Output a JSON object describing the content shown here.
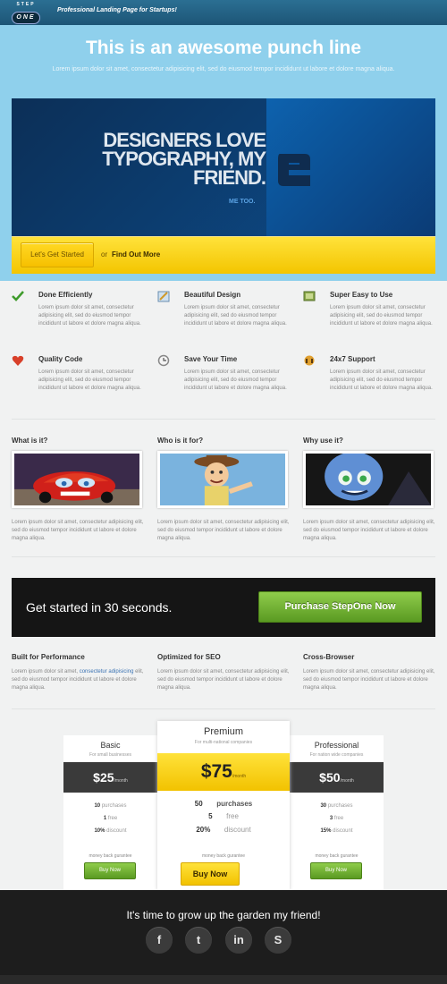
{
  "header": {
    "logo_top": "STEP",
    "logo_bottom": "ONE",
    "tagline": "Professional Landing Page for Startups!"
  },
  "hero": {
    "punchline": "This is an awesome punch line",
    "subtitle": "Lorem ipsum dolor sit amet, consectetur adipisicing elit, sed do eiusmod tempor incididunt ut labore et dolore magna aliqua.",
    "banner_headline": "DESIGNERS LOVE TYPOGRAPHY, MY FRIEND.",
    "banner_tag": "ME TOO.",
    "cta_button": "Let's Get Started",
    "or": "or",
    "find_out": "Find Out More"
  },
  "features": [
    {
      "title": "Done Efficiently",
      "icon": "checkmark-icon",
      "text": "Lorem ipsum dolor sit amet, consectetur adipisicing elit, sed do eiusmod tempor incididunt ut labore et dolore magna aliqua."
    },
    {
      "title": "Beautiful Design",
      "icon": "design-icon",
      "text": "Lorem ipsum dolor sit amet, consectetur adipisicing elit, sed do eiusmod tempor incididunt ut labore et dolore magna aliqua."
    },
    {
      "title": "Super Easy to Use",
      "icon": "image-icon",
      "text": "Lorem ipsum dolor sit amet, consectetur adipisicing elit, sed do eiusmod tempor incididunt ut labore et dolore magna aliqua."
    },
    {
      "title": "Quality Code",
      "icon": "heart-icon",
      "text": "Lorem ipsum dolor sit amet, consectetur adipisicing elit, sed do eiusmod tempor incididunt ut labore et dolore magna aliqua."
    },
    {
      "title": "Save Your Time",
      "icon": "clock-icon",
      "text": "Lorem ipsum dolor sit amet, consectetur adipisicing elit, sed do eiusmod tempor incididunt ut labore et dolore magna aliqua."
    },
    {
      "title": "24x7 Support",
      "icon": "support-icon",
      "text": "Lorem ipsum dolor sit amet, consectetur adipisicing elit, sed do eiusmod tempor incididunt ut labore et dolore magna aliqua."
    }
  ],
  "info": [
    {
      "title": "What is it?",
      "text": "Lorem ipsum dolor sit amet, consectetur adipisicing elit, sed do eiusmod tempor incididunt ut labore et dolore magna aliqua."
    },
    {
      "title": "Who is it for?",
      "text": "Lorem ipsum dolor sit amet, consectetur adipisicing elit, sed do eiusmod tempor incididunt ut labore et dolore magna aliqua."
    },
    {
      "title": "Why use it?",
      "text": "Lorem ipsum dolor sit amet, consectetur adipisicing elit, sed do eiusmod tempor incididunt ut labore et dolore magna aliqua."
    }
  ],
  "cta": {
    "text": "Get started in 30 seconds.",
    "button": "Purchase StepOne Now"
  },
  "benefits": [
    {
      "title": "Built for Performance",
      "text_before": "Lorem ipsum dolor sit amet, ",
      "link": "consectetur adipisicing",
      "text_after": " elit, sed do eiusmod tempor incididunt ut labore et dolore magna aliqua."
    },
    {
      "title": "Optimized for SEO",
      "text": "Lorem ipsum dolor sit amet, consectetur adipisicing elit, sed do eiusmod tempor incididunt ut labore et dolore magna aliqua."
    },
    {
      "title": "Cross-Browser",
      "text": "Lorem ipsum dolor sit amet, consectetur adipisicing elit, sed do eiusmod tempor incididunt ut labore et dolore magna aliqua."
    }
  ],
  "pricing": {
    "basic": {
      "name": "Basic",
      "sub": "For small businesses",
      "price": "$25",
      "per": "/month",
      "purchases": "10",
      "purchases_label": "purchases",
      "free": "1",
      "free_label": "free",
      "discount": "10%",
      "discount_label": "discount",
      "guarantee": "money back gurantee",
      "button": "Buy Now"
    },
    "premium": {
      "name": "Premium",
      "sub": "For multi-national companies",
      "price": "$75",
      "per": "/month",
      "purchases": "50",
      "purchases_label": "purchases",
      "free": "5",
      "free_label": "free",
      "discount": "20%",
      "discount_label": "discount",
      "guarantee": "money back gurantee",
      "button": "Buy Now"
    },
    "professional": {
      "name": "Professional",
      "sub": "For nation wide companies",
      "price": "$50",
      "per": "/month",
      "purchases": "30",
      "purchases_label": "purchases",
      "free": "3",
      "free_label": "free",
      "discount": "15%",
      "discount_label": "discount",
      "guarantee": "money back gurantee",
      "button": "Buy Now"
    }
  },
  "footer": {
    "text": "It's time to grow up the garden my friend!",
    "social": [
      {
        "icon": "facebook-icon",
        "glyph": "f"
      },
      {
        "icon": "twitter-icon",
        "glyph": "t"
      },
      {
        "icon": "linkedin-icon",
        "glyph": "in"
      },
      {
        "icon": "skype-icon",
        "glyph": "S"
      }
    ]
  },
  "colors": {
    "brand_blue": "#1d5576",
    "hero_sky": "#8fd0ec",
    "accent_yellow": "#f6c000",
    "accent_green": "#6aa82e",
    "footer_dark": "#1d1d1d"
  }
}
